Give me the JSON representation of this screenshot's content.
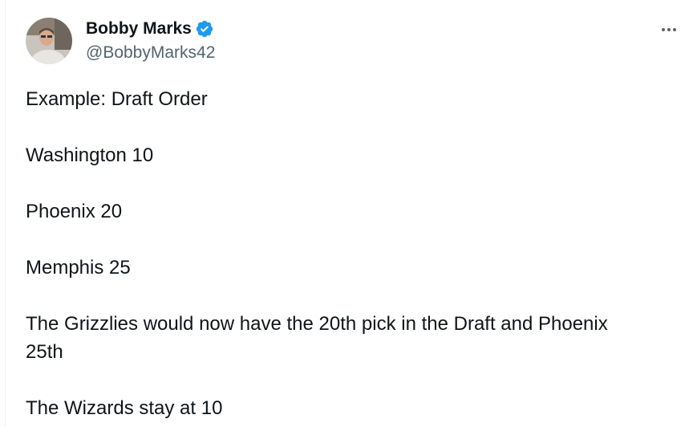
{
  "author": {
    "name": "Bobby Marks",
    "handle": "@BobbyMarks42"
  },
  "icons": {
    "verified": "verified-badge-icon",
    "more": "more-options-icon"
  },
  "colors": {
    "verified": "#1d9bf0",
    "handle": "#536471",
    "text": "#0f1419"
  },
  "tweet": {
    "lines": [
      "Example: Draft Order",
      "Washington 10",
      "Phoenix 20",
      "Memphis 25",
      "The Grizzlies would now have the 20th pick in the Draft and Phoenix 25th",
      "The Wizards stay at 10"
    ]
  }
}
